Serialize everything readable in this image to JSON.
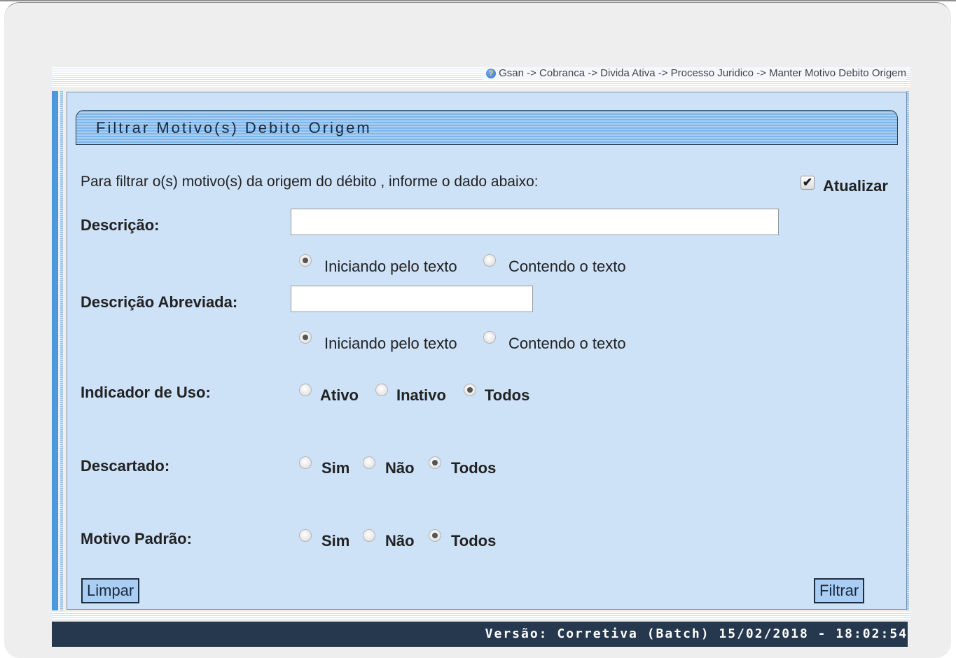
{
  "breadcrumb": "Gsan -> Cobranca -> Divida Ativa -> Processo Juridico -> Manter Motivo Debito Origem",
  "panel_title": "Filtrar Motivo(s) Debito Origem",
  "instructions": "Para filtrar o(s) motivo(s) da origem do débito , informe o dado abaixo:",
  "atualizar": {
    "label": "Atualizar",
    "checked": true,
    "mark": "✔"
  },
  "descricao": {
    "label": "Descrição:",
    "value": "",
    "opt1": "Iniciando pelo texto",
    "opt2": "Contendo o texto",
    "selected": "Iniciando pelo texto"
  },
  "descricao_abreviada": {
    "label": "Descrição Abreviada:",
    "value": "",
    "opt1": "Iniciando pelo texto",
    "opt2": "Contendo o texto",
    "selected": "Iniciando pelo texto"
  },
  "indicador_uso": {
    "label": "Indicador de Uso:",
    "opt1": "Ativo",
    "opt2": "Inativo",
    "opt3": "Todos",
    "selected": "Todos"
  },
  "descartado": {
    "label": "Descartado:",
    "opt1": "Sim",
    "opt2": "Não",
    "opt3": "Todos",
    "selected": "Todos"
  },
  "motivo_padrao": {
    "label": "Motivo Padrão:",
    "opt1": "Sim",
    "opt2": "Não",
    "opt3": "Todos",
    "selected": "Todos"
  },
  "buttons": {
    "limpar": "Limpar",
    "filtrar": "Filtrar"
  },
  "footer": "Versão: Corretiva (Batch) 15/02/2018 - 18:02:54",
  "colors": {
    "panel_bg": "#cde1f7",
    "footer_bg": "#25384d",
    "title_bar": "#7fb6ea"
  },
  "icons": {
    "help": "help-icon"
  }
}
